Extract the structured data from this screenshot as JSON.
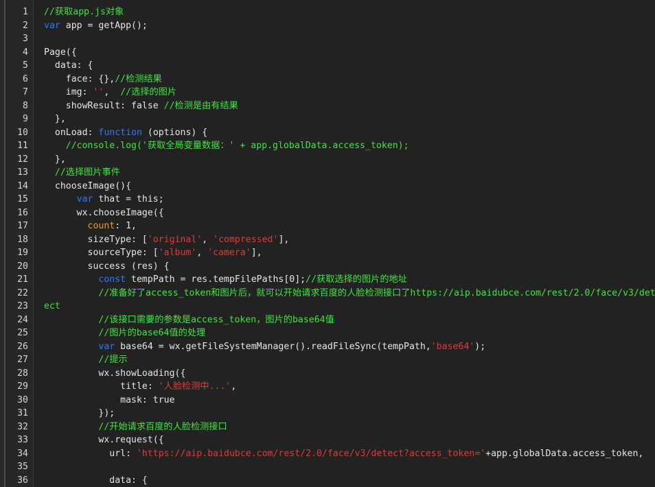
{
  "colors": {
    "background": "#222222",
    "gutter": "#272727",
    "line_number": "#d8d8d8",
    "plain": "#e6e6e6",
    "comment": "#3ee63e",
    "keyword": "#2a7cff",
    "string": "#e23a3a",
    "property": "#f0a020"
  },
  "lines": [
    {
      "num": "1",
      "tokens": [
        {
          "t": "comment",
          "v": "//获取app.js对象"
        }
      ]
    },
    {
      "num": "2",
      "tokens": [
        {
          "t": "kw",
          "v": "var"
        },
        {
          "t": "plain",
          "v": " app = getApp();"
        }
      ]
    },
    {
      "num": "3",
      "tokens": []
    },
    {
      "num": "4",
      "tokens": [
        {
          "t": "plain",
          "v": "Page({"
        }
      ]
    },
    {
      "num": "5",
      "tokens": [
        {
          "t": "plain",
          "v": "  data: {"
        }
      ]
    },
    {
      "num": "6",
      "tokens": [
        {
          "t": "plain",
          "v": "    face: {},"
        },
        {
          "t": "comment",
          "v": "//检测结果"
        }
      ]
    },
    {
      "num": "7",
      "tokens": [
        {
          "t": "plain",
          "v": "    img: "
        },
        {
          "t": "str",
          "v": "''"
        },
        {
          "t": "plain",
          "v": ",  "
        },
        {
          "t": "comment",
          "v": "//选择的图片"
        }
      ]
    },
    {
      "num": "8",
      "tokens": [
        {
          "t": "plain",
          "v": "    showResult: false "
        },
        {
          "t": "comment",
          "v": "//检测是由有结果"
        }
      ]
    },
    {
      "num": "9",
      "tokens": [
        {
          "t": "plain",
          "v": "  },"
        }
      ]
    },
    {
      "num": "10",
      "tokens": [
        {
          "t": "plain",
          "v": "  onLoad: "
        },
        {
          "t": "kw",
          "v": "function"
        },
        {
          "t": "plain",
          "v": " (options) {"
        }
      ]
    },
    {
      "num": "11",
      "tokens": [
        {
          "t": "comment",
          "v": "    //console.log('获取全局变量数据：' + app.globalData.access_token);"
        }
      ]
    },
    {
      "num": "12",
      "tokens": [
        {
          "t": "plain",
          "v": "  },"
        }
      ]
    },
    {
      "num": "13",
      "tokens": [
        {
          "t": "comment",
          "v": "  //选择图片事件"
        }
      ]
    },
    {
      "num": "14",
      "tokens": [
        {
          "t": "plain",
          "v": "  chooseImage(){"
        }
      ]
    },
    {
      "num": "15",
      "tokens": [
        {
          "t": "plain",
          "v": "      "
        },
        {
          "t": "kw",
          "v": "var"
        },
        {
          "t": "plain",
          "v": " that = this;"
        }
      ]
    },
    {
      "num": "16",
      "tokens": [
        {
          "t": "plain",
          "v": "      wx.chooseImage({"
        }
      ]
    },
    {
      "num": "17",
      "tokens": [
        {
          "t": "plain",
          "v": "        "
        },
        {
          "t": "prop",
          "v": "count"
        },
        {
          "t": "plain",
          "v": ": 1,"
        }
      ]
    },
    {
      "num": "18",
      "tokens": [
        {
          "t": "plain",
          "v": "        sizeType: ["
        },
        {
          "t": "str",
          "v": "'original'"
        },
        {
          "t": "plain",
          "v": ", "
        },
        {
          "t": "str",
          "v": "'compressed'"
        },
        {
          "t": "plain",
          "v": "],"
        }
      ]
    },
    {
      "num": "19",
      "tokens": [
        {
          "t": "plain",
          "v": "        sourceType: ["
        },
        {
          "t": "str",
          "v": "'album'"
        },
        {
          "t": "plain",
          "v": ", "
        },
        {
          "t": "str",
          "v": "'camera'"
        },
        {
          "t": "plain",
          "v": "],"
        }
      ]
    },
    {
      "num": "20",
      "tokens": [
        {
          "t": "plain",
          "v": "        success (res) {"
        }
      ]
    },
    {
      "num": "21",
      "tokens": [
        {
          "t": "plain",
          "v": "          "
        },
        {
          "t": "kw",
          "v": "const"
        },
        {
          "t": "plain",
          "v": " tempPath = res.tempFilePaths[0];"
        },
        {
          "t": "comment",
          "v": "//获取选择的图片的地址"
        }
      ]
    },
    {
      "num": "22",
      "tokens": [
        {
          "t": "comment",
          "v": "          //准备好了access_token和图片后，就可以开始请求百度的人脸检测接口了https://aip.baidubce.com/rest/2.0/face/v3/det"
        }
      ]
    },
    {
      "num": "23",
      "wrap": true,
      "tokens": [
        {
          "t": "comment",
          "v": "ect"
        }
      ]
    },
    {
      "num": "24",
      "tokens": [
        {
          "t": "comment",
          "v": "          //该接口需要的参数是access_token，图片的base64值"
        }
      ]
    },
    {
      "num": "25",
      "tokens": [
        {
          "t": "comment",
          "v": "          //图片的base64值的处理"
        }
      ]
    },
    {
      "num": "26",
      "tokens": [
        {
          "t": "plain",
          "v": "          "
        },
        {
          "t": "kw",
          "v": "var"
        },
        {
          "t": "plain",
          "v": " base64 = wx.getFileSystemManager().readFileSync(tempPath,"
        },
        {
          "t": "str",
          "v": "'base64'"
        },
        {
          "t": "plain",
          "v": ");"
        }
      ]
    },
    {
      "num": "27",
      "tokens": [
        {
          "t": "comment",
          "v": "          //提示"
        }
      ]
    },
    {
      "num": "28",
      "tokens": [
        {
          "t": "plain",
          "v": "          wx.showLoading({"
        }
      ]
    },
    {
      "num": "29",
      "tokens": [
        {
          "t": "plain",
          "v": "              title: "
        },
        {
          "t": "str",
          "v": "'人脸检测中...'"
        },
        {
          "t": "plain",
          "v": ","
        }
      ]
    },
    {
      "num": "30",
      "tokens": [
        {
          "t": "plain",
          "v": "              mask: true"
        }
      ]
    },
    {
      "num": "31",
      "tokens": [
        {
          "t": "plain",
          "v": "          });"
        }
      ]
    },
    {
      "num": "32",
      "tokens": [
        {
          "t": "comment",
          "v": "          //开始请求百度的人脸检测接口"
        }
      ]
    },
    {
      "num": "33",
      "tokens": [
        {
          "t": "plain",
          "v": "          wx.request({"
        }
      ]
    },
    {
      "num": "34",
      "tokens": [
        {
          "t": "plain",
          "v": "            url: "
        },
        {
          "t": "str",
          "v": "'https://aip.baidubce.com/rest/2.0/face/v3/detect?access_token='"
        },
        {
          "t": "plain",
          "v": "+app.globalData.access_token,"
        }
      ]
    },
    {
      "num": "35",
      "tokens": []
    },
    {
      "num": "36",
      "tokens": [
        {
          "t": "plain",
          "v": "            data: {"
        }
      ]
    }
  ]
}
